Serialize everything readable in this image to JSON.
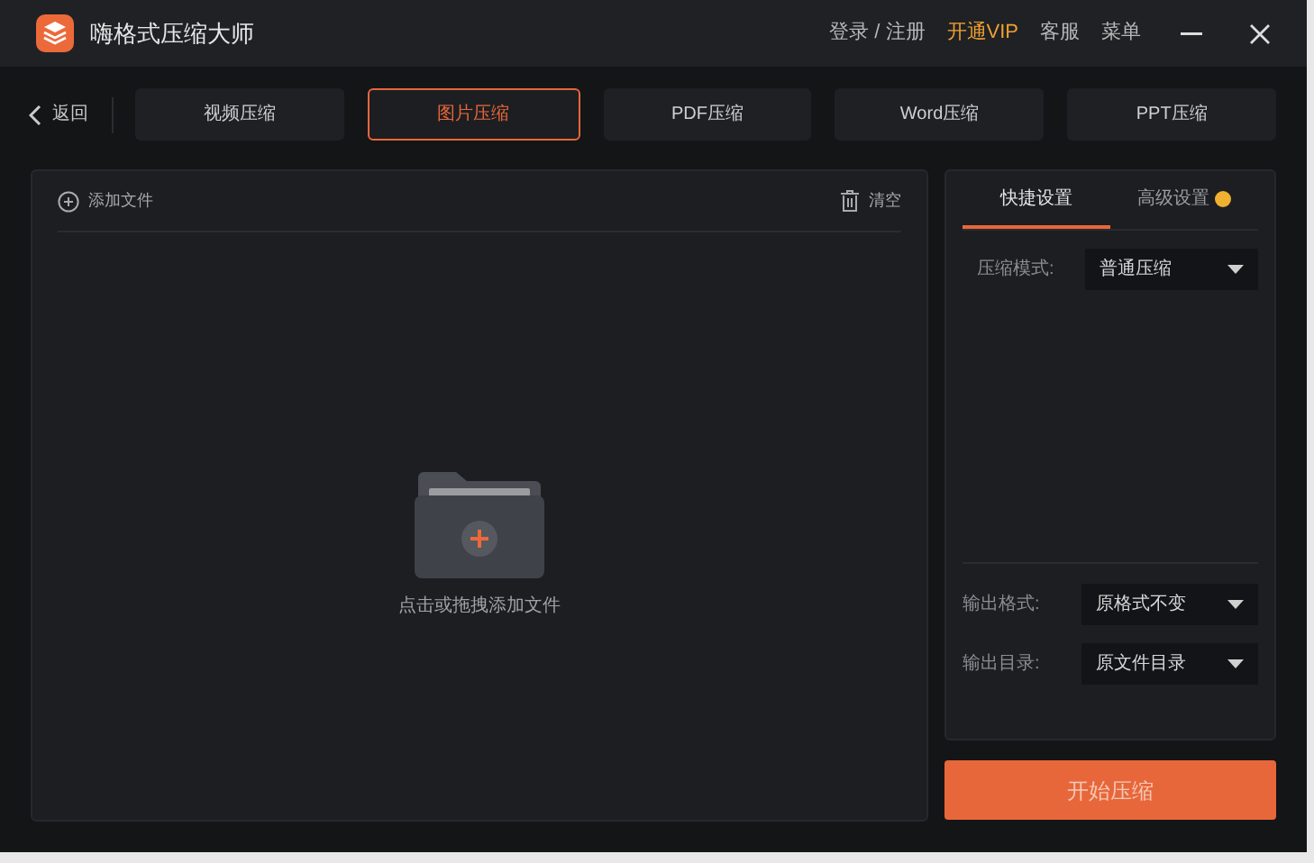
{
  "app": {
    "title": "嗨格式压缩大师"
  },
  "header_links": [
    {
      "label": "登录 / 注册",
      "kind": "plain"
    },
    {
      "label": "开通VIP",
      "kind": "vip"
    },
    {
      "label": "客服",
      "kind": "plain"
    },
    {
      "label": "菜单",
      "kind": "plain"
    }
  ],
  "back": {
    "label": "返回"
  },
  "tabs": [
    {
      "label": "视频压缩",
      "selected": false
    },
    {
      "label": "图片压缩",
      "selected": true
    },
    {
      "label": "PDF压缩",
      "selected": false
    },
    {
      "label": "Word压缩",
      "selected": false
    },
    {
      "label": "PPT压缩",
      "selected": false
    }
  ],
  "file_panel": {
    "add_label": "添加文件",
    "clear_label": "清空",
    "drop_hint": "点击或拖拽添加文件"
  },
  "settings_tabs": [
    {
      "label": "快捷设置",
      "selected": true,
      "vip": false
    },
    {
      "label": "高级设置",
      "selected": false,
      "vip": true
    }
  ],
  "top_fields": [
    {
      "label": "压缩模式:",
      "value": "普通压缩"
    }
  ],
  "bottom_fields": [
    {
      "label": "输出格式:",
      "value": "原格式不变"
    },
    {
      "label": "输出目录:",
      "value": "原文件目录"
    }
  ],
  "start_button": {
    "label": "开始压缩"
  }
}
